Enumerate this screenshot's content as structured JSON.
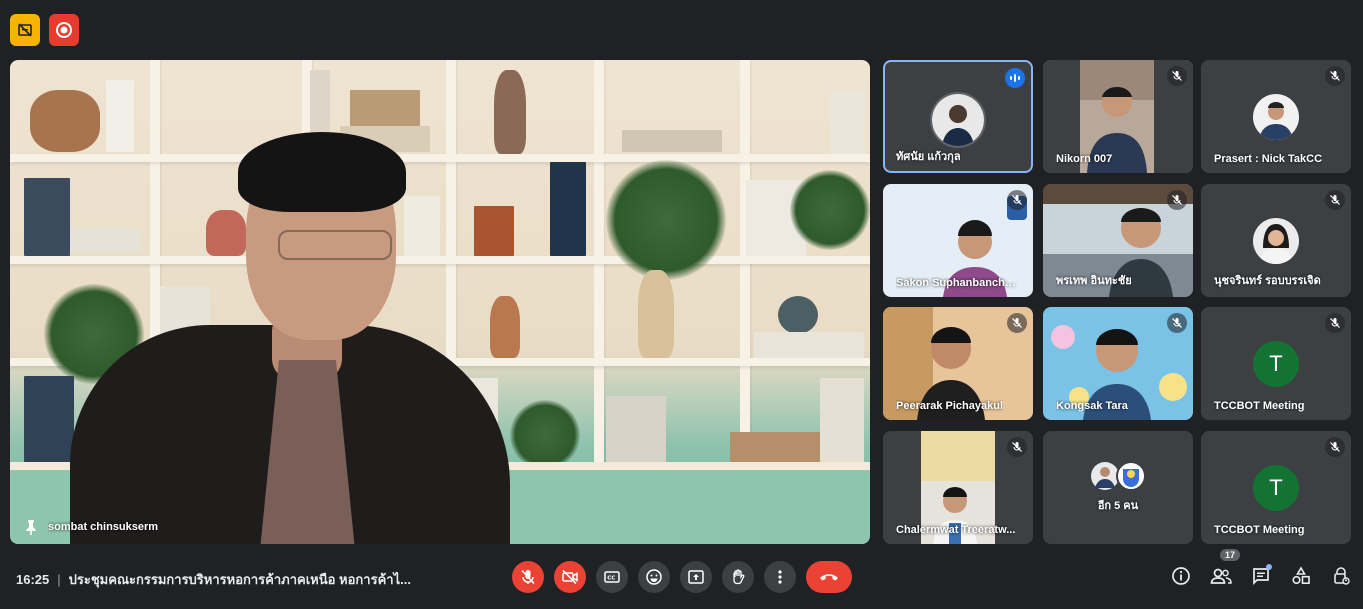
{
  "topbar": {
    "record_indicator": "record-icon",
    "captions_indicator": "no-captions-icon"
  },
  "main_tile": {
    "name": "sombat chinsukserm",
    "pin_icon": "pin-icon"
  },
  "tiles": [
    {
      "name": "ทัศนัย แก้วกุล",
      "speaking": true
    },
    {
      "name": "Nikorn 007",
      "muted": true
    },
    {
      "name": "Prasert : Nick TakCC",
      "muted": true
    },
    {
      "name": "Sakon Suphanbancho...",
      "muted": true
    },
    {
      "name": "พรเทพ อินทะชัย",
      "muted": true
    },
    {
      "name": "นุชจรินทร์ รอบบรรเจิด",
      "muted": true
    },
    {
      "name": "Peerarak Pichayakul",
      "muted": true
    },
    {
      "name": "Kongsak Tara",
      "muted": true
    },
    {
      "name": "TCCBOT Meeting",
      "muted": true,
      "avatar_letter": "T"
    },
    {
      "name": "Chalermwat Treeratw...",
      "muted": true
    },
    {
      "name": "อีก 5 คน"
    },
    {
      "name": "TCCBOT Meeting",
      "muted": true,
      "avatar_letter": "T"
    }
  ],
  "bottombar": {
    "time": "16:25",
    "separator": "|",
    "meeting_title": "ประชุมคณะกรรมการบริหารหอการค้าภาคเหนือ หอการค้าไ...",
    "participants_count": "17"
  },
  "colors": {
    "background": "#202124",
    "tile": "#3c4043",
    "danger": "#ea4335",
    "accent": "#8ab4f8",
    "avatar_green": "#137333"
  }
}
